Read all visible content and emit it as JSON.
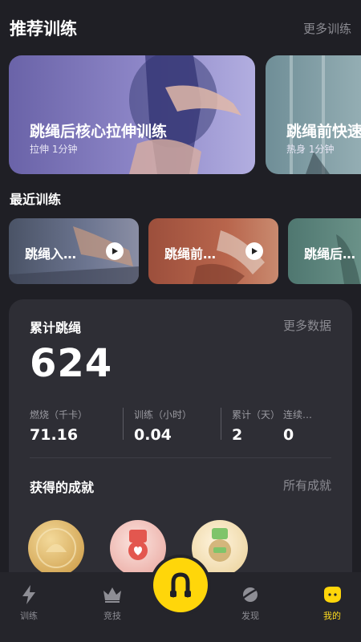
{
  "recommended": {
    "title": "推荐训练",
    "more": "更多训练",
    "cards": [
      {
        "title": "跳绳后核心拉伸训练",
        "sub": "拉伸 1分钟"
      },
      {
        "title": "跳绳前快速",
        "sub": "热身 1分钟"
      }
    ]
  },
  "recent": {
    "title": "最近训练",
    "cards": [
      {
        "title": "跳绳入…"
      },
      {
        "title": "跳绳前…"
      },
      {
        "title": "跳绳后…"
      }
    ]
  },
  "stats": {
    "title": "累计跳绳",
    "more": "更多数据",
    "total": "624",
    "items": [
      {
        "label": "燃烧（千卡）",
        "value": "71.16"
      },
      {
        "label": "训练（小时）",
        "value": "0.04"
      },
      {
        "label": "累计（天）",
        "value": "2"
      },
      {
        "label": "连续…",
        "value": "0"
      }
    ]
  },
  "achievements": {
    "title": "获得的成就",
    "more": "所有成就",
    "medals": [
      {
        "icon": "gold-medal-icon",
        "color": "#d9b062"
      },
      {
        "icon": "pink-heart-medal-icon",
        "color": "#f0b3ad"
      },
      {
        "icon": "green-badge-medal-icon",
        "color": "#e9d3a0"
      }
    ]
  },
  "tabbar": {
    "items": [
      {
        "label": "训练",
        "icon": "lightning-icon"
      },
      {
        "label": "竞技",
        "icon": "crown-icon"
      },
      {
        "label": "发现",
        "icon": "planet-icon"
      },
      {
        "label": "我的",
        "icon": "face-icon"
      }
    ],
    "active": "我的",
    "center_icon": "rope-icon"
  },
  "colors": {
    "background": "#1f1f25",
    "panel": "#2e2e35",
    "accent": "#ffd60a",
    "muted_text": "#8c8c93"
  }
}
